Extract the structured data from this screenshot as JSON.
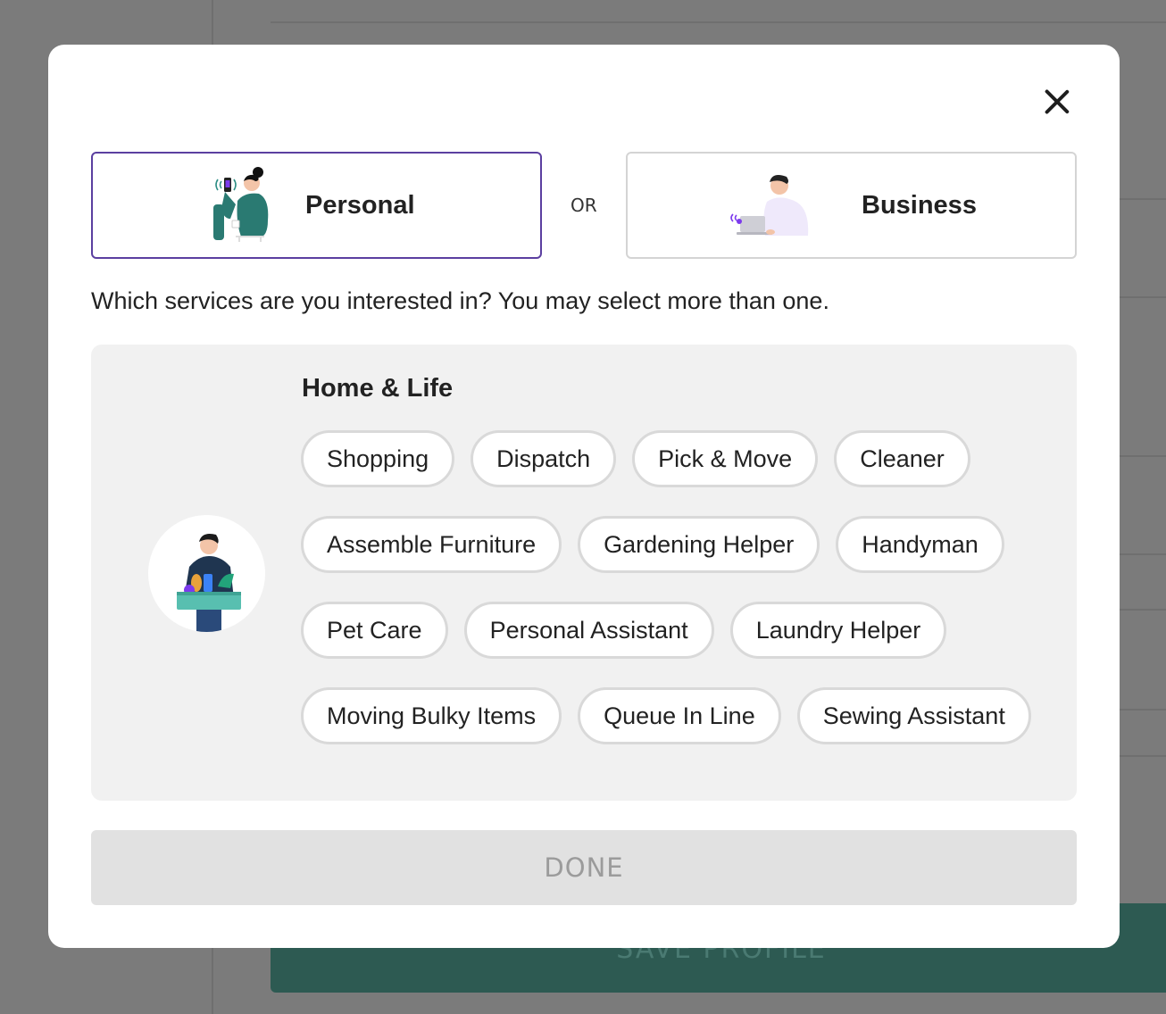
{
  "background": {
    "save_button_label": "SAVE PROFILE"
  },
  "modal": {
    "close_icon": "close-icon",
    "or_label": "OR",
    "account_types": [
      {
        "label": "Personal",
        "selected": true,
        "illustration": "woman-with-phone-icon"
      },
      {
        "label": "Business",
        "selected": false,
        "illustration": "man-with-laptop-icon"
      }
    ],
    "question": "Which services are you interested in? You may select more than one.",
    "category": {
      "title": "Home & Life",
      "illustration": "man-holding-box-icon",
      "rows": [
        [
          "Shopping",
          "Dispatch",
          "Pick & Move",
          "Cleaner"
        ],
        [
          "Assemble Furniture",
          "Gardening Helper",
          "Handyman"
        ],
        [
          "Pet Care",
          "Personal Assistant",
          "Laundry Helper"
        ],
        [
          "Moving Bulky Items",
          "Queue In Line",
          "Sewing Assistant"
        ]
      ]
    },
    "done_label": "DONE"
  },
  "colors": {
    "selected_border": "#5b3fa0",
    "accent_teal": "#2d5a52",
    "done_disabled_bg": "#e1e1e1"
  }
}
